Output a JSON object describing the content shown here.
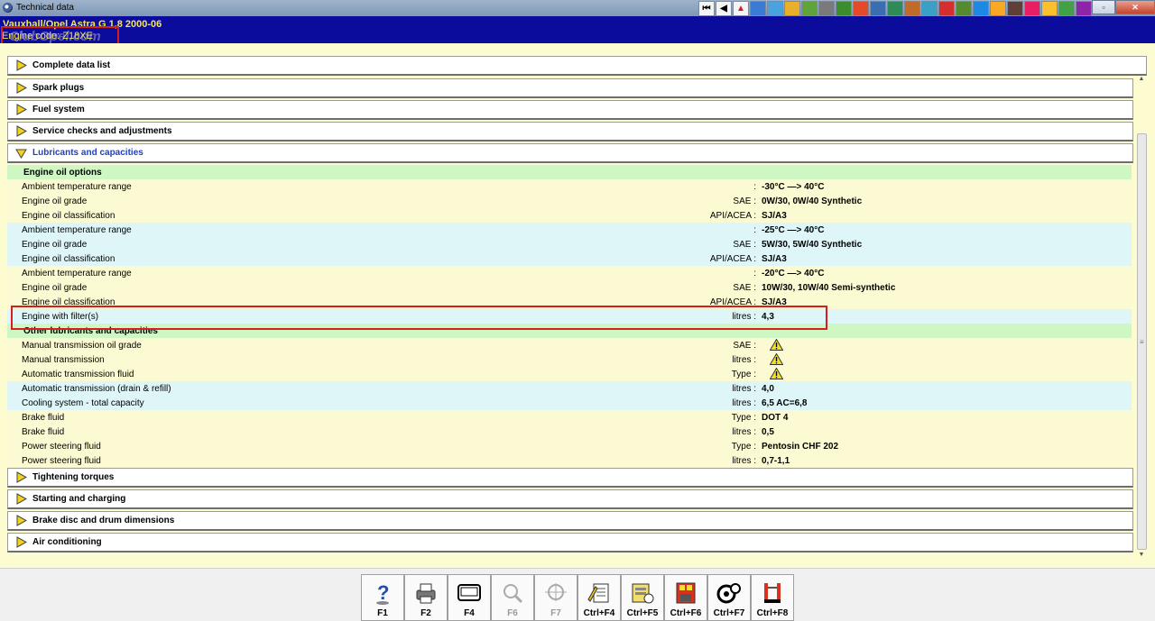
{
  "window": {
    "title": "Technical data"
  },
  "toolbar": {
    "icons": [
      "first-icon",
      "prev-icon",
      "warning-icon",
      "vehicle-icon",
      "map-icon",
      "tools-icon",
      "wheel-icon",
      "clock-icon",
      "gauge-icon",
      "chart-icon",
      "book-icon",
      "person-icon",
      "engine-icon",
      "fan-icon",
      "battery-icon",
      "diagram-icon",
      "pen-icon",
      "flag-icon",
      "wrench-icon",
      "car-icon",
      "triangle-icon",
      "globe-icon",
      "module-icon"
    ],
    "colors": [
      "#f4f4f4",
      "#f4f4f4",
      "#d52020",
      "#3a7bd5",
      "#4aa3df",
      "#e8b02a",
      "#5fa33a",
      "#7a7a7a",
      "#3c8d2e",
      "#e34a2a",
      "#3b6db3",
      "#2e8b57",
      "#c06b2a",
      "#3aa0c8",
      "#d32f2f",
      "#558b2f",
      "#1e88e5",
      "#f9a825",
      "#5d4037",
      "#e91e63",
      "#fbc02d",
      "#43a047",
      "#8e24aa"
    ]
  },
  "window_controls": {
    "restore": "▫",
    "close": "✕"
  },
  "vehicle": {
    "line": "Vauxhall/Opel  Astra G  1,8  2000-06",
    "engine_code": "Engine code: Z18XE",
    "watermark": "ClubOpel.com"
  },
  "sections": {
    "complete": "Complete data list",
    "spark": "Spark plugs",
    "fuel": "Fuel system",
    "service": "Service checks and adjustments",
    "lubricants": "Lubricants and capacities",
    "tightening": "Tightening torques",
    "starting": "Starting and charging",
    "brake_disc": "Brake disc and drum dimensions",
    "aircon": "Air conditioning"
  },
  "subheads": {
    "engine_oil": "Engine oil options",
    "other": "Other lubricants and capacities"
  },
  "rows": [
    {
      "label": "Ambient temperature range",
      "unit": ":",
      "value": "-30°C —> 40°C"
    },
    {
      "label": "Engine oil grade",
      "unit": "SAE :",
      "value": "0W/30, 0W/40 Synthetic"
    },
    {
      "label": "Engine oil classification",
      "unit": "API/ACEA :",
      "value": "SJ/A3"
    },
    {
      "label": "Ambient temperature range",
      "unit": ":",
      "value": "-25°C —> 40°C"
    },
    {
      "label": "Engine oil grade",
      "unit": "SAE :",
      "value": "5W/30, 5W/40 Synthetic"
    },
    {
      "label": "Engine oil classification",
      "unit": "API/ACEA :",
      "value": "SJ/A3"
    },
    {
      "label": "Ambient temperature range",
      "unit": ":",
      "value": "-20°C —> 40°C"
    },
    {
      "label": "Engine oil grade",
      "unit": "SAE :",
      "value": "10W/30, 10W/40 Semi-synthetic"
    },
    {
      "label": "Engine oil classification",
      "unit": "API/ACEA :",
      "value": "SJ/A3"
    },
    {
      "label": "Engine with filter(s)",
      "unit": "litres :",
      "value": "4,3"
    },
    {
      "label": "Manual transmission oil grade",
      "unit": "SAE :",
      "value": ""
    },
    {
      "label": "Manual transmission",
      "unit": "litres :",
      "value": ""
    },
    {
      "label": "Automatic transmission fluid",
      "unit": "Type :",
      "value": ""
    },
    {
      "label": "Automatic transmission (drain & refill)",
      "unit": "litres :",
      "value": "4,0"
    },
    {
      "label": "Cooling system - total capacity",
      "unit": "litres :",
      "value": "6,5 AC=6,8"
    },
    {
      "label": "Brake fluid",
      "unit": "Type :",
      "value": "DOT 4"
    },
    {
      "label": "Brake fluid",
      "unit": "litres :",
      "value": "0,5"
    },
    {
      "label": "Power steering fluid",
      "unit": "Type :",
      "value": "Pentosin CHF 202"
    },
    {
      "label": "Power steering fluid",
      "unit": "litres :",
      "value": "0,7-1,1"
    }
  ],
  "scrollbar": {
    "up": "▲",
    "down": "▼",
    "grip": "≡"
  },
  "fkeys": [
    {
      "label": "F1",
      "icon": "help-icon",
      "enabled": true
    },
    {
      "label": "F2",
      "icon": "print-icon",
      "enabled": true
    },
    {
      "label": "F4",
      "icon": "screen-icon",
      "enabled": true
    },
    {
      "label": "F6",
      "icon": "detail-icon",
      "enabled": false,
      "icon_text": "Detail"
    },
    {
      "label": "F7",
      "icon": "zoom-icon",
      "enabled": false
    },
    {
      "label": "Ctrl+F4",
      "icon": "notes-icon",
      "enabled": true
    },
    {
      "label": "Ctrl+F5",
      "icon": "clipboard-icon",
      "enabled": true
    },
    {
      "label": "Ctrl+F6",
      "icon": "calculator-icon",
      "enabled": true
    },
    {
      "label": "Ctrl+F7",
      "icon": "settings-icon",
      "enabled": true
    },
    {
      "label": "Ctrl+F8",
      "icon": "exit-icon",
      "enabled": true
    }
  ],
  "colors": {
    "header_bg": "#0b0b9c",
    "header_text": "#f5e65e",
    "highlight": "#d21f1f",
    "open_section_text": "#1f3ec8",
    "subhead_bg": "#cff7c4",
    "row_yellow": "#fcfad2",
    "row_cyan": "#dff6f8"
  }
}
